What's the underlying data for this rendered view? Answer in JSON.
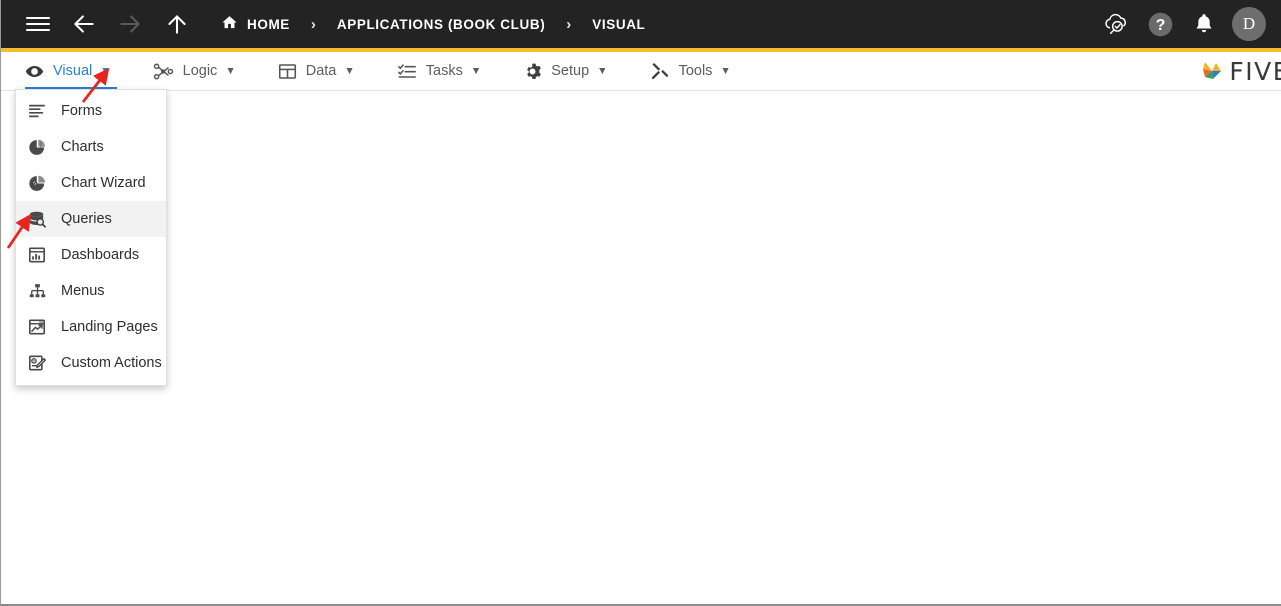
{
  "header": {
    "menu_icon": "hamburger-menu-icon",
    "back_icon": "arrow-left-icon",
    "forward_icon": "arrow-right-icon",
    "up_icon": "arrow-up-icon",
    "breadcrumb": [
      {
        "label": "HOME",
        "icon": "home-icon"
      },
      {
        "label": "APPLICATIONS (BOOK CLUB)",
        "icon": ""
      },
      {
        "label": "VISUAL",
        "icon": ""
      }
    ],
    "separator": "›",
    "actions": [
      {
        "name": "cloud-search-icon",
        "label": ""
      },
      {
        "name": "help-icon",
        "label": "?"
      },
      {
        "name": "notifications-bell-icon",
        "label": ""
      }
    ],
    "avatar_initial": "D",
    "accent_color": "#f5bc2b",
    "background_color": "#232323"
  },
  "menubar": {
    "caret": "▼",
    "active_tab": "Visual",
    "active_color": "#2a7fd4",
    "tabs": [
      {
        "label": "Visual",
        "icon": "eye-icon",
        "active": true
      },
      {
        "label": "Logic",
        "icon": "flow-nodes-icon",
        "active": false
      },
      {
        "label": "Data",
        "icon": "table-grid-icon",
        "active": false
      },
      {
        "label": "Tasks",
        "icon": "checklist-icon",
        "active": false
      },
      {
        "label": "Setup",
        "icon": "gear-icon",
        "active": false
      },
      {
        "label": "Tools",
        "icon": "tools-cross-icon",
        "active": false
      }
    ],
    "brand": {
      "name": "five-logo",
      "text": "FIVE"
    }
  },
  "dropdown": {
    "owner": "Visual",
    "items": [
      {
        "label": "Forms",
        "icon": "forms-lines-icon",
        "hover": false
      },
      {
        "label": "Charts",
        "icon": "pie-chart-icon",
        "hover": false
      },
      {
        "label": "Chart Wizard",
        "icon": "chart-wizard-icon",
        "hover": false
      },
      {
        "label": "Queries",
        "icon": "database-search-icon",
        "hover": true
      },
      {
        "label": "Dashboards",
        "icon": "dashboard-icon",
        "hover": false
      },
      {
        "label": "Menus",
        "icon": "sitemap-icon",
        "hover": false
      },
      {
        "label": "Landing Pages",
        "icon": "landing-page-icon",
        "hover": false
      },
      {
        "label": "Custom Actions",
        "icon": "custom-action-icon",
        "hover": false
      }
    ]
  },
  "annotations": {
    "color": "#e8251c",
    "arrows": [
      {
        "name": "arrow-pointing-to-visual-dropdown",
        "target": "Visual"
      },
      {
        "name": "arrow-pointing-to-queries-item",
        "target": "Queries"
      }
    ]
  }
}
